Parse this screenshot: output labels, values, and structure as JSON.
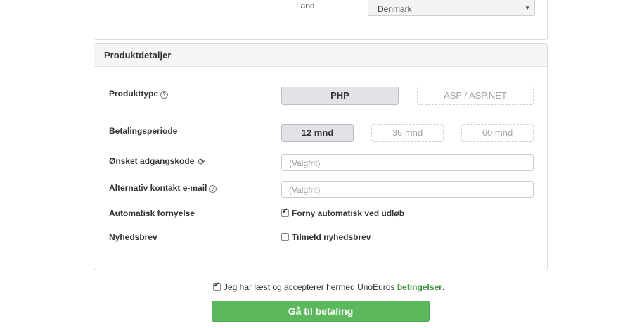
{
  "land": {
    "label": "Land",
    "selected": "Denmark"
  },
  "panel": {
    "title": "Produktdetaljer",
    "produkttype": {
      "label": "Produkttype",
      "options": [
        "PHP",
        "ASP / ASP.NET"
      ],
      "selected": "PHP"
    },
    "betalingsperiode": {
      "label": "Betalingsperiode",
      "options": [
        "12 mnd",
        "36 mnd",
        "60 mnd"
      ],
      "selected": "12 mnd"
    },
    "adgangskode": {
      "label": "Ønsket adgangskode",
      "placeholder": "(Valgfrit)"
    },
    "kontakt_email": {
      "label": "Alternativ kontakt e-mail",
      "placeholder": "(Valgfrit)"
    },
    "fornyelse": {
      "label": "Automatisk fornyelse",
      "checkbox_label": "Forny automatisk ved udløb",
      "checked": true
    },
    "nyhedsbrev": {
      "label": "Nyhedsbrev",
      "checkbox_label": "Tilmeld nyhedsbrev",
      "checked": false
    }
  },
  "terms": {
    "text": "Jeg har læst og accepterer hermed UnoEuros",
    "link": "betingelser",
    "suffix": ".",
    "checked": true
  },
  "submit": {
    "label": "Gå til betaling"
  },
  "colors": {
    "primary_button": "#5cb85c",
    "link": "#3b8e3b",
    "active_option": "#e2e3e6"
  }
}
